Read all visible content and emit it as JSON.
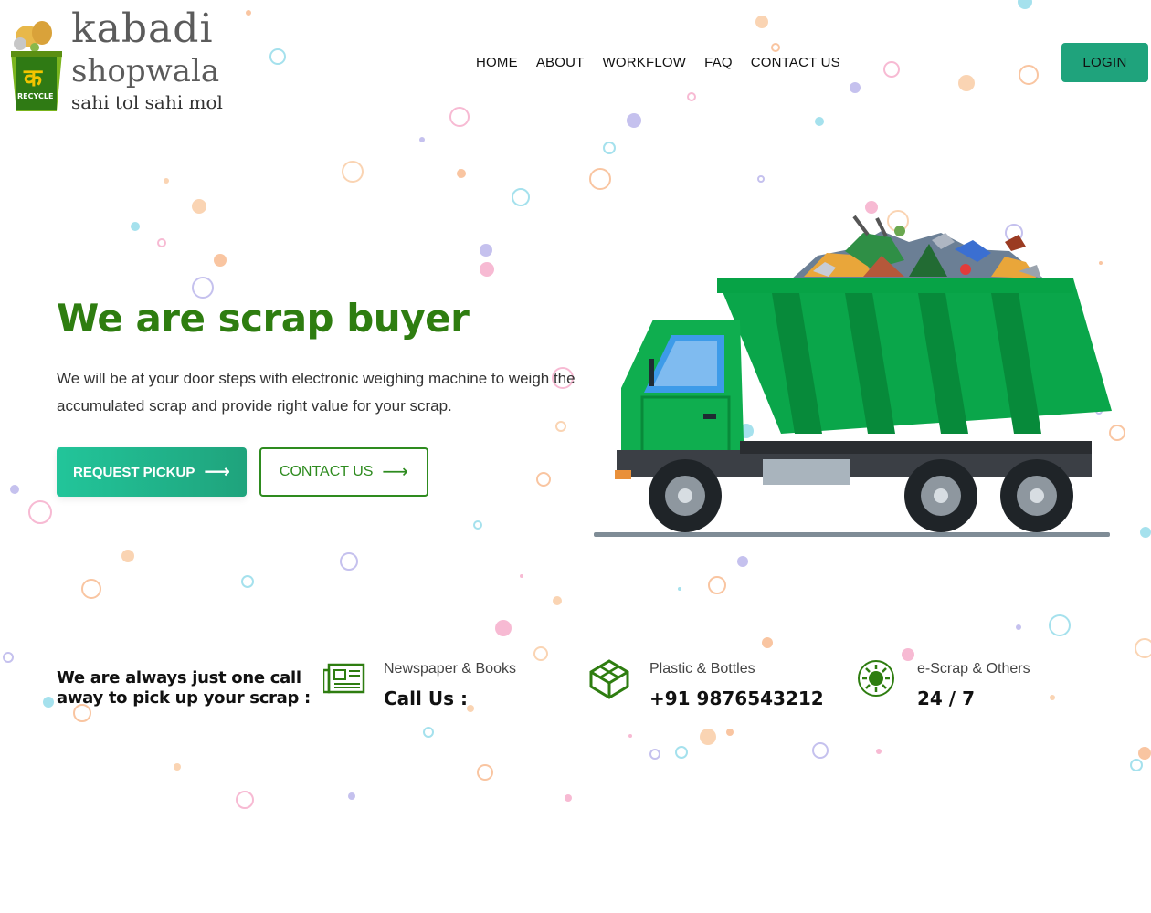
{
  "brand": {
    "bin_label_hindi": "क",
    "bin_label": "RECYCLE",
    "name_line1": "kabadi",
    "name_line2": "shopwala",
    "tagline": "sahi tol sahi mol"
  },
  "nav": {
    "items": [
      "HOME",
      "ABOUT",
      "WORKFLOW",
      "FAQ",
      "CONTACT US"
    ]
  },
  "login_label": "LOGIN",
  "hero": {
    "title": "We are scrap buyer",
    "description": "We will be at your door steps with electronic weighing machine to weigh the accumulated scrap and provide right value for your scrap.",
    "pickup_label": "REQUEST PICKUP",
    "contact_label": "CONTACT US",
    "arrow": "⟶"
  },
  "call_section": {
    "heading": "We are always just one call away to pick up your scrap :",
    "features": [
      {
        "icon": "newspaper-icon",
        "label": "Newspaper & Books",
        "value": "Call Us :"
      },
      {
        "icon": "cube-icon",
        "label": "Plastic & Bottles",
        "value": "+91 9876543212"
      },
      {
        "icon": "chip-icon",
        "label": "e-Scrap & Others",
        "value": "24 / 7"
      }
    ]
  },
  "colors": {
    "primary_green": "#2e7d10",
    "button_teal": "#1fa37c",
    "truck_green": "#0aa64a"
  }
}
